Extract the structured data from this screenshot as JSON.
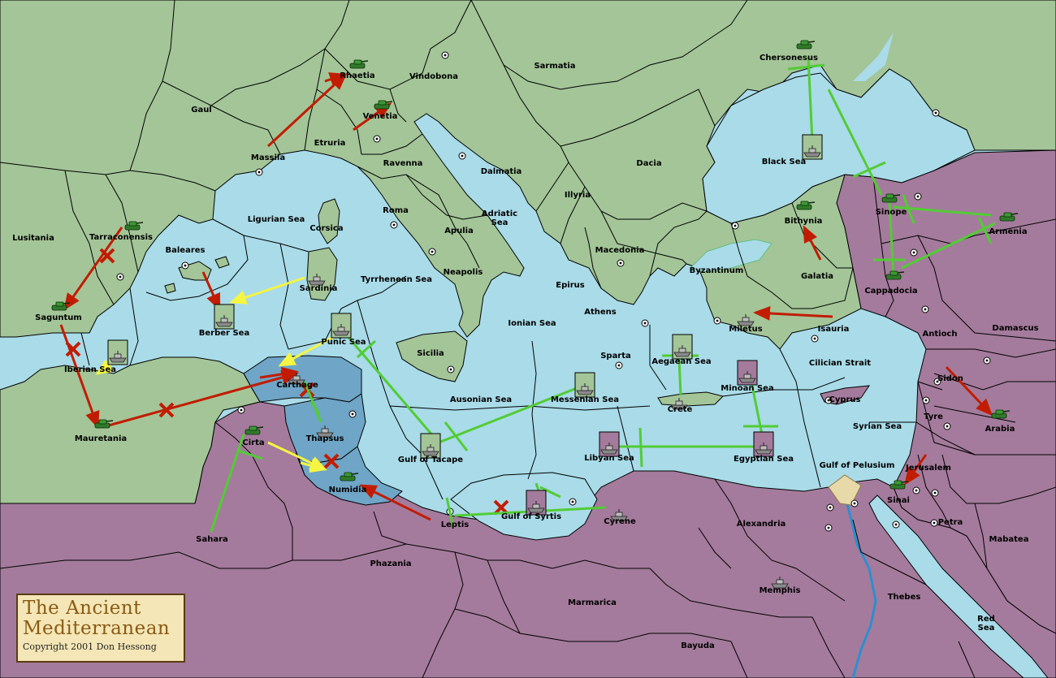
{
  "map": {
    "colors": {
      "sea": "#a9dbe8",
      "land_green": "#a3c598",
      "land_purple": "#a47b9c",
      "land_neutral": "#a4c597",
      "carthage_region": "#6fa5c6",
      "move_red": "#c21c00",
      "move_yellow": "#f5f542",
      "support_green": "#52cc34",
      "river": "#2c8ed0"
    },
    "regions": {
      "gaul": "Gaul",
      "massila": "Massila",
      "rhaetia": "Rhaetia",
      "vindobona": "Vindobona",
      "sarmatia": "Sarmatia",
      "venetia": "Venetia",
      "etruria": "Etruria",
      "ravenna": "Ravenna",
      "dalmatia": "Dalmatia",
      "dacia": "Dacia",
      "chersonesus": "Chersonesus",
      "black_sea": "Black Sea",
      "lusitania": "Lusitania",
      "tarraconensis": "Tarraconensis",
      "baleares": "Baleares",
      "ligurian_sea": "Ligurian Sea",
      "corsica": "Corsica",
      "roma": "Roma",
      "illyria": "Illyria",
      "apulia": "Apulia",
      "adriatic_sea": "Adriatic\nSea",
      "bithynia": "Bithynia",
      "sinope": "Sinope",
      "armenia": "Armenia",
      "saguntum": "Saguntum",
      "sardinia": "Sardinia",
      "tyrrhenean_sea": "Tyrrhenean Sea",
      "neapolis": "Neapolis",
      "macedonia": "Macedonia",
      "byzantinum": "Byzantinum",
      "galatia": "Galatia",
      "cappadocia": "Cappadocia",
      "berber_sea": "Berber Sea",
      "epirus": "Epirus",
      "athens": "Athens",
      "miletus": "Miletus",
      "isauria": "Isauria",
      "iberian_sea": "Iberian Sea",
      "punic_sea": "Punic Sea",
      "ionian_sea": "Ionian Sea",
      "sicilia": "Sicilia",
      "sparta": "Sparta",
      "aegaean_sea": "Aegaean Sea",
      "cilician_strait": "Cilician Strait",
      "antioch": "Antioch",
      "damascus": "Damascus",
      "carthage": "Carthage",
      "sidon": "Sidon",
      "minoan_sea": "Minoan Sea",
      "cyprus": "Cyprus",
      "mauretania": "Mauretania",
      "ausonian_sea": "Ausonian Sea",
      "messenian_sea": "Messenian Sea",
      "crete": "Crete",
      "tyre": "Tyre",
      "arabia": "Arabia",
      "syrian_sea": "Syrian Sea",
      "cirta": "Cirta",
      "thapsus": "Thapsus",
      "gulf_of_tacape": "Gulf of Tacape",
      "libyan_sea": "Libyan Sea",
      "egyptian_sea": "Egyptian Sea",
      "gulf_of_pelusium": "Gulf of Pelusium",
      "jerusalem": "Jerusalem",
      "numidia": "Numidia",
      "sinai": "Sinai",
      "gulf_of_syrtis": "Gulf of Syrtis",
      "cyrene": "Cyrene",
      "leptis": "Leptis",
      "sahara": "Sahara",
      "alexandria": "Alexandria",
      "petra": "Petra",
      "mabatea": "Mabatea",
      "phazania": "Phazania",
      "memphis": "Memphis",
      "thebes": "Thebes",
      "marmarica": "Marmarica",
      "red_sea": "Red\nSea",
      "bayuda": "Bayuda"
    },
    "units": {
      "armies": [
        "Rhaetia",
        "Venetia",
        "Chersonesus",
        "Tarraconensis",
        "Bithynia",
        "Sinope",
        "Armenia",
        "Saguntum",
        "Cappadocia",
        "Mauretania",
        "Arabia",
        "Cirta",
        "Numidia",
        "Sinai"
      ],
      "fleets": [
        "Black Sea",
        "Sardinia",
        "Berber Sea",
        "Punic Sea",
        "Iberian Sea",
        "Miletus",
        "Aegaean Sea",
        "Minoan Sea",
        "Carthage",
        "Messenian Sea",
        "Crete",
        "Thapsus",
        "Gulf of Tacape",
        "Libyan Sea",
        "Egyptian Sea",
        "Gulf of Syrtis",
        "Cyrene",
        "Memphis"
      ]
    }
  },
  "cartouche": {
    "title_line1": "The Ancient",
    "title_line2": "Mediterranean",
    "copyright": "Copyright  2001  Don Hessong"
  }
}
